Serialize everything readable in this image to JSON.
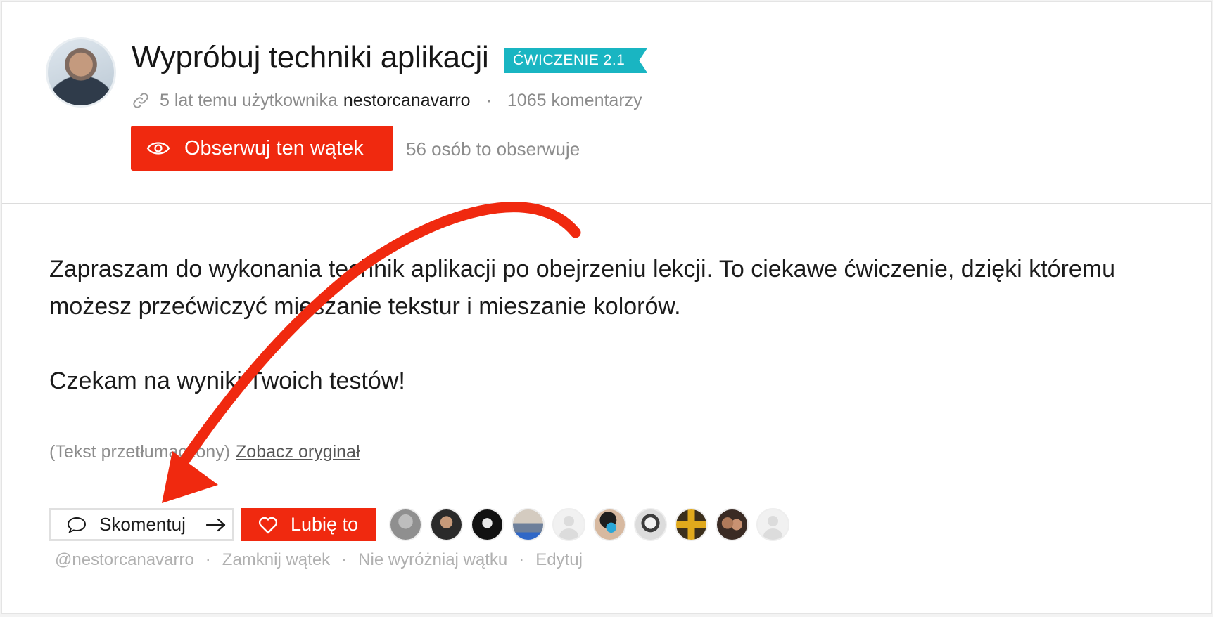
{
  "thread": {
    "title": "Wypróbuj techniki aplikacji",
    "badge": "ĆWICZENIE 2.1",
    "time_text": "5 lat temu użytkownika",
    "author": "nestorcanavarro",
    "meta_separator": "·",
    "comments": "1065 komentarzy",
    "follow_label": "Obserwuj ten wątek",
    "followers_text": "56 osób to obserwuje"
  },
  "body": {
    "paragraph1": "Zapraszam do wykonania technik aplikacji po obejrzeniu lekcji. To ciekawe ćwiczenie, dzięki któremu możesz przećwiczyć mieszanie tekstur i mieszanie kolorów.",
    "paragraph2": "Czekam na wyniki Twoich testów!",
    "translated_label": "(Tekst przetłumaczony)",
    "view_original": "Zobacz oryginał"
  },
  "buttons": {
    "comment_label": "Skomentuj",
    "like_label": "Lubię to"
  },
  "actions": {
    "mention": "@nestorcanavarro",
    "close": "Zamknij wątek",
    "unfeature": "Nie wyróżniaj wątku",
    "edit": "Edytuj",
    "separator": "·"
  },
  "colors": {
    "accent_red": "#f0290f",
    "badge_teal": "#19b5c2",
    "annotation_arrow": "#f0290f"
  },
  "icons": {
    "link": "link-icon",
    "eye": "eye-icon",
    "comment": "speech-bubble-icon",
    "arrow": "arrow-right-icon",
    "heart": "heart-icon"
  }
}
